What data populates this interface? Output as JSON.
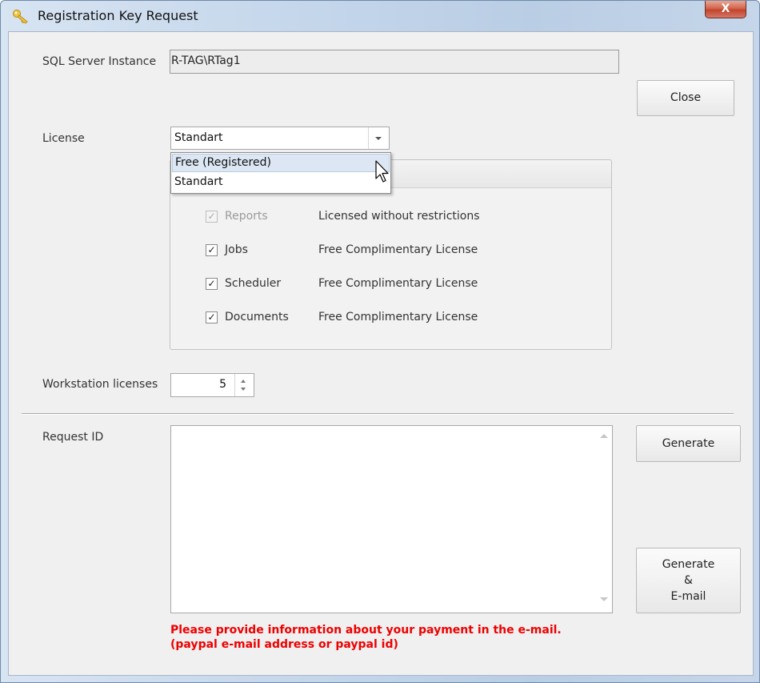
{
  "window": {
    "title": "Registration Key  Request",
    "close_glyph": "X",
    "title_icon": "key-icon"
  },
  "sql_server": {
    "label": "SQL Server Instance",
    "value": "R-TAG\\RTag1"
  },
  "close_button": {
    "label": "Close"
  },
  "license": {
    "label": "License",
    "selected": "Standart",
    "options": [
      "Free (Registered)",
      "Standart"
    ],
    "hovered_option": "Free (Registered)"
  },
  "modules": [
    {
      "name": "Reports",
      "checked": true,
      "disabled": true,
      "status": "Licensed without restrictions"
    },
    {
      "name": "Jobs",
      "checked": true,
      "disabled": false,
      "status": "Free Complimentary License"
    },
    {
      "name": "Scheduler",
      "checked": true,
      "disabled": false,
      "status": "Free Complimentary License"
    },
    {
      "name": "Documents",
      "checked": true,
      "disabled": false,
      "status": "Free Complimentary License"
    }
  ],
  "workstation": {
    "label": "Workstation licenses",
    "value": "5"
  },
  "request": {
    "label": "Request ID",
    "value": ""
  },
  "buttons": {
    "generate": "Generate",
    "generate_email_line1": "Generate",
    "generate_email_line2": "&",
    "generate_email_line3": "E-mail"
  },
  "notice": {
    "line1": "Please  provide information about your payment in the e-mail.",
    "line2": "(paypal e-mail address or paypal id)"
  },
  "colors": {
    "notice": "#ee0000",
    "close_button": "#c2432a",
    "hover": "#dde7f3"
  }
}
